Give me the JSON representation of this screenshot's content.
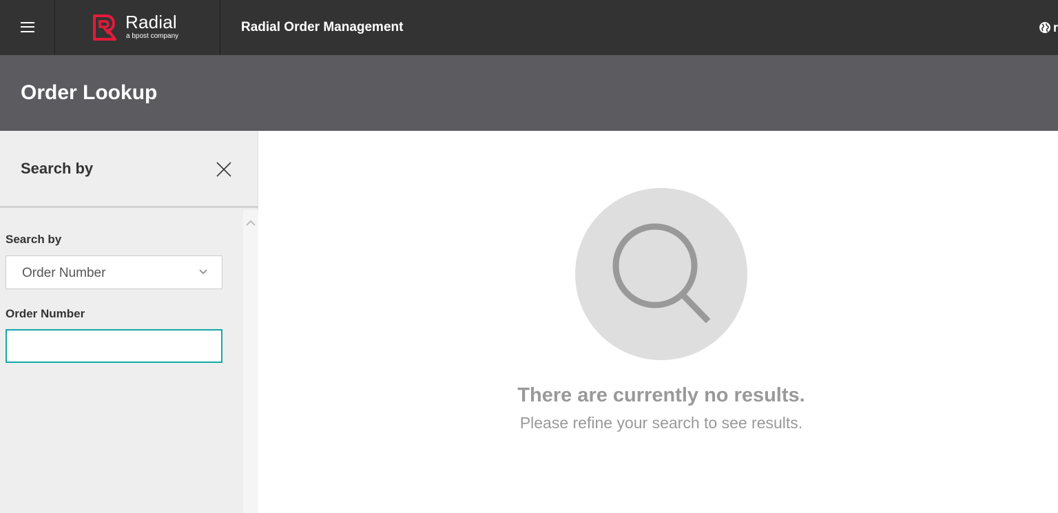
{
  "brand": {
    "name": "Radial",
    "tagline": "a bpost company",
    "accent_color": "#e31b3b"
  },
  "header": {
    "app_title": "Radial Order Management",
    "globe_text": "r",
    "icons": [
      "hamburger-menu-icon",
      "radial-logo-icon",
      "globe-icon"
    ]
  },
  "page": {
    "title": "Order Lookup"
  },
  "sidebar": {
    "title": "Search by",
    "search_by_label": "Search by",
    "search_by_value": "Order Number",
    "order_number_label": "Order Number",
    "order_number_value": "",
    "input_border_color": "#12a8a8"
  },
  "empty_state": {
    "title": "There are currently no results.",
    "subtitle": "Please refine your search to see results.",
    "icon": "magnifier-icon"
  },
  "colors": {
    "topbar": "#333333",
    "page_header": "#5b5b60",
    "sidebar_bg": "#eeeeee"
  }
}
